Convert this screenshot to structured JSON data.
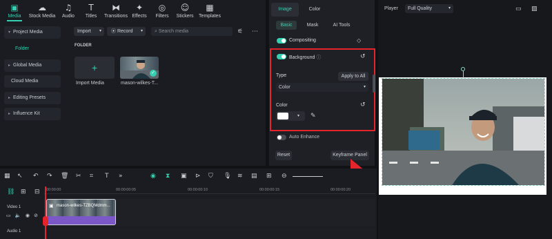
{
  "toolbar": {
    "tabs": [
      {
        "label": "Media",
        "icon": "media-icon"
      },
      {
        "label": "Stock Media",
        "icon": "stock-media-icon"
      },
      {
        "label": "Audio",
        "icon": "audio-icon"
      },
      {
        "label": "Titles",
        "icon": "titles-icon"
      },
      {
        "label": "Transitions",
        "icon": "transitions-icon"
      },
      {
        "label": "Effects",
        "icon": "effects-icon"
      },
      {
        "label": "Filters",
        "icon": "filters-icon"
      },
      {
        "label": "Stickers",
        "icon": "stickers-icon"
      },
      {
        "label": "Templates",
        "icon": "templates-icon"
      }
    ]
  },
  "sidebar": {
    "items": [
      {
        "label": "Project Media"
      },
      {
        "label": "Folder"
      },
      {
        "label": "Global Media"
      },
      {
        "label": "Cloud Media"
      },
      {
        "label": "Editing Presets"
      },
      {
        "label": "Influence Kit"
      }
    ]
  },
  "media": {
    "import_label": "Import",
    "record_label": "Record",
    "search_placeholder": "Search media",
    "folder_heading": "FOLDER",
    "items": [
      {
        "label": "Import Media"
      },
      {
        "label": "mason-wilkes-T..."
      }
    ]
  },
  "props": {
    "tabs": [
      "Image",
      "Color"
    ],
    "subtabs": [
      "Basic",
      "Mask",
      "AI Tools"
    ],
    "compositing_label": "Compositing",
    "background_label": "Background",
    "type_label": "Type",
    "apply_all_label": "Apply to All",
    "type_value": "Color",
    "color_label": "Color",
    "auto_enhance_label": "Auto Enhance",
    "reset_label": "Reset",
    "keyframe_label": "Keyframe Panel"
  },
  "player": {
    "label": "Player",
    "quality": "Full Quality"
  },
  "timeline": {
    "times": [
      "00:00:00",
      "00:00:00:05",
      "00:00:00:10",
      "00:00:00:15",
      "00:00:00:20"
    ],
    "tracks": [
      {
        "label": "Video 1"
      },
      {
        "label": "Audio 1"
      }
    ],
    "clip_label": "mason-wilkes-TZBQMdmm..."
  },
  "colors": {
    "accent": "#35d0b1",
    "highlight": "#e5242c",
    "clip": "#7b57c8"
  }
}
